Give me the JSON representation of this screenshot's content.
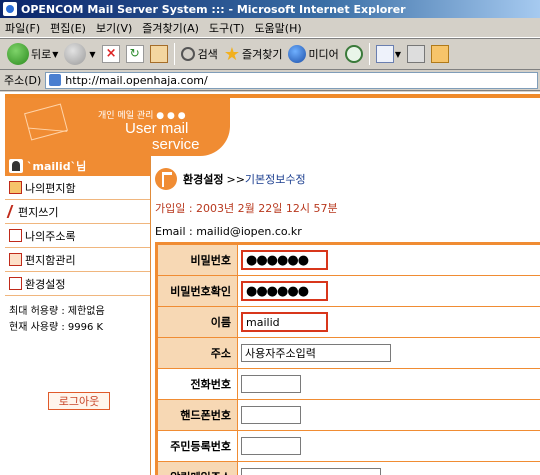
{
  "window": {
    "title": "OPENCOM Mail Server System ::: - Microsoft Internet Explorer"
  },
  "menubar": {
    "items": [
      "파일(F)",
      "편집(E)",
      "보기(V)",
      "즐겨찾기(A)",
      "도구(T)",
      "도움말(H)"
    ]
  },
  "toolbar": {
    "back_label": "뒤로",
    "search_label": "검색",
    "favorites_label": "즐겨찾기",
    "media_label": "미디어",
    "icons": [
      "back-icon",
      "forward-icon",
      "stop-icon",
      "refresh-icon",
      "home-icon",
      "search-icon",
      "favorites-star-icon",
      "media-icon",
      "history-icon",
      "mail-icon",
      "print-icon",
      "edit-icon"
    ]
  },
  "addressbar": {
    "label": "주소(D)",
    "url": "http://mail.openhaja.com/"
  },
  "banner": {
    "small_text": "개인 메일 관리 ● ● ●",
    "line1": "User mail",
    "line2": "service",
    "color": "#f08c33"
  },
  "sidebar": {
    "user": "`mailid`님",
    "nav": [
      {
        "label": "나의편지함",
        "icon": "mailbox-icon"
      },
      {
        "label": "편지쓰기",
        "icon": "pencil-icon"
      },
      {
        "label": "나의주소록",
        "icon": "addressbook-icon"
      },
      {
        "label": "편지함관리",
        "icon": "folder-manage-icon"
      },
      {
        "label": "환경설정",
        "icon": "settings-icon"
      }
    ],
    "quota_max": "최대 허용량 : 제한없음",
    "quota_used": "현재 사용량 : 9996 K",
    "logout_label": "로그아웃"
  },
  "content": {
    "breadcrumb_main": "환경설정",
    "breadcrumb_sep": ">>",
    "breadcrumb_sub": "기본정보수정",
    "joined": "가입일 : 2003년 2월 22일 12시 57분",
    "email": "Email : mailid@iopen.co.kr"
  },
  "form": {
    "rows": [
      {
        "label": "비밀번호",
        "value": "●●●●●●"
      },
      {
        "label": "비밀번호확인",
        "value": "●●●●●●"
      },
      {
        "label": "이름",
        "value": "mailid"
      },
      {
        "label": "주소",
        "value": "사용자주소입력"
      },
      {
        "label": "전화번호",
        "value": ""
      },
      {
        "label": "핸드폰번호",
        "value": ""
      },
      {
        "label": "주민등록번호",
        "value": ""
      },
      {
        "label": "알림메일주소",
        "value": ""
      }
    ]
  },
  "colors": {
    "accent": "#f08c33",
    "label_bg": "#f7d8b4",
    "highlight_border": "#d8361b"
  }
}
